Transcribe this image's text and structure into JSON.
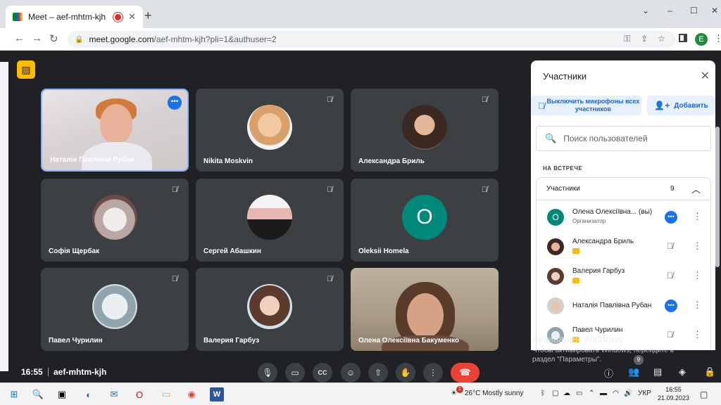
{
  "browser": {
    "tab_title": "Meet – aef-mhtm-kjh",
    "tab_close": "✕",
    "new_tab": "+",
    "window_controls": [
      "⌄",
      "–",
      "☐",
      "✕"
    ],
    "url_host": "meet.google.com",
    "url_path": "/aef-mhtm-kjh?pli=1&authuser=2",
    "profile_initial": "E",
    "icons": [
      "back-icon",
      "forward-icon",
      "reload-icon",
      "lock-icon",
      "key-icon",
      "share-icon",
      "star-icon",
      "sidebar-icon",
      "more-icon"
    ]
  },
  "meet": {
    "clock": "16:55",
    "meeting_code": "aef-mhtm-kjh",
    "tiles": [
      {
        "name": "Наталія Павлівна Рубан",
        "type": "video"
      },
      {
        "name": "Nikita Moskvin",
        "type": "avatar"
      },
      {
        "name": "Александра Бриль",
        "type": "avatar"
      },
      {
        "name": "Софія Щербак",
        "type": "avatar"
      },
      {
        "name": "Сергей Абашкин",
        "type": "avatar"
      },
      {
        "name": "Oleksii Homela",
        "type": "letter",
        "letter": "O",
        "color": "#00897b"
      },
      {
        "name": "Павел Чурилин",
        "type": "avatar"
      },
      {
        "name": "Валерия Гарбуз",
        "type": "avatar"
      },
      {
        "name": "Олена Олексіївна Бакуменко",
        "type": "video"
      }
    ],
    "controls": [
      "mic-icon",
      "camera-icon",
      "captions-icon",
      "emoji-icon",
      "present-icon",
      "raise-hand-icon",
      "more-options-icon",
      "end-call-icon"
    ],
    "right_controls": [
      "info-icon",
      "people-icon",
      "chat-icon",
      "activities-icon",
      "host-controls-icon"
    ],
    "people_count": "9"
  },
  "panel": {
    "title": "Участники",
    "mute_all_label": "Выключить микрофоны всех участников",
    "add_label": "Добавить",
    "search_placeholder": "Поиск пользователей",
    "section_label": "НА ВСТРЕЧЕ",
    "group_label": "Участники",
    "group_count": "9",
    "rows": [
      {
        "name": "Олена Олексіївна... (вы)",
        "sub": "Организатор",
        "avatar": "O",
        "avatar_color": "#00897b",
        "state": "more"
      },
      {
        "name": "Александра Бриль",
        "sub": "",
        "state": "muted"
      },
      {
        "name": "Валерия Гарбуз",
        "sub": "",
        "state": "muted"
      },
      {
        "name": "Наталія Павлівна Рубан",
        "sub": "",
        "state": "more"
      },
      {
        "name": "Павел Чурилин",
        "sub": "",
        "state": "muted"
      }
    ]
  },
  "watermark": {
    "line1": "Активация Windows",
    "line2": "Чтобы активировать Windows, перейдите в",
    "line3": "раздел \"Параметры\"."
  },
  "taskbar": {
    "weather": "26°C  Mostly sunny",
    "weather_alert": "1",
    "lang": "УКР",
    "time": "16:55",
    "date": "21.09.2023",
    "word_label": "W",
    "chrome_badge": "E"
  },
  "colors": {
    "accent": "#1a73e8",
    "end_call": "#ea4335",
    "meet_bg": "#202124",
    "tile_bg": "#3c4043"
  }
}
